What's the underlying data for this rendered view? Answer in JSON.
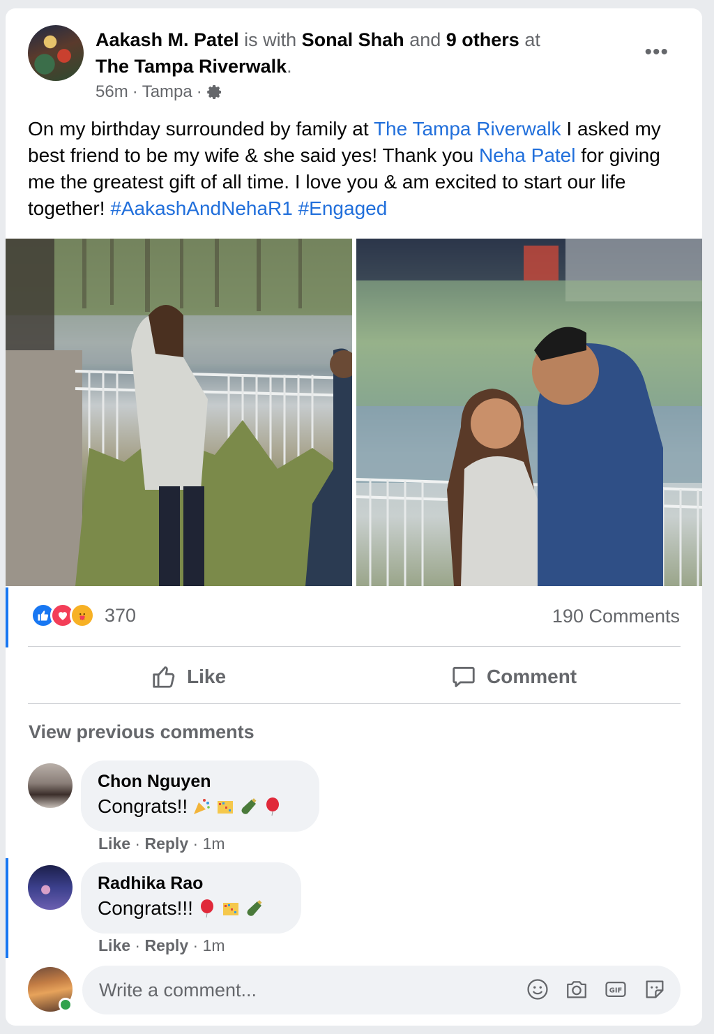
{
  "post": {
    "author": "Aakash M. Patel",
    "with_word": "is with",
    "tagged_friend": "Sonal Shah",
    "and_word": "and",
    "others": "9 others",
    "at_word": "at",
    "location": "The Tampa Riverwalk",
    "period": ".",
    "time": "56m",
    "dot1": "·",
    "city": "Tampa",
    "dot2": "·",
    "text_1": "On my birthday surrounded by family at ",
    "text_link_place": "The Tampa Riverwalk",
    "text_2": " I asked my best friend to be my wife & she said yes! Thank you ",
    "text_link_person": "Neha Patel",
    "text_3": " for giving me the greatest gift of all time. I love you & am excited to start our life together! ",
    "hashtag_1": "#AakashAndNehaR1",
    "space": " ",
    "hashtag_2": "#Engaged",
    "more_icon": "•••"
  },
  "stats": {
    "reaction_count": "370",
    "comments_count": "190 Comments"
  },
  "actions": {
    "like": "Like",
    "comment": "Comment"
  },
  "comments_section": {
    "view_previous": "View previous comments",
    "items": [
      {
        "name": "Chon Nguyen",
        "text": "Congrats!!",
        "like": "Like",
        "reply": "Reply",
        "sep": "·",
        "time": "1m"
      },
      {
        "name": "Radhika Rao",
        "text": "Congrats!!!",
        "like": "Like",
        "reply": "Reply",
        "sep": "·",
        "time": "1m"
      }
    ]
  },
  "composer": {
    "placeholder": "Write a comment..."
  },
  "icons": [
    "more-icon",
    "gear-icon",
    "like-reaction-icon",
    "love-reaction-icon",
    "care-reaction-icon",
    "thumbs-up-icon",
    "comment-bubble-icon",
    "emoji-icon",
    "camera-icon",
    "gif-icon",
    "sticker-icon"
  ],
  "colors": {
    "link": "#216fdb",
    "muted": "#65676b",
    "like_blue": "#1877f2",
    "love_red": "#f33e58",
    "online_green": "#31a24c"
  }
}
